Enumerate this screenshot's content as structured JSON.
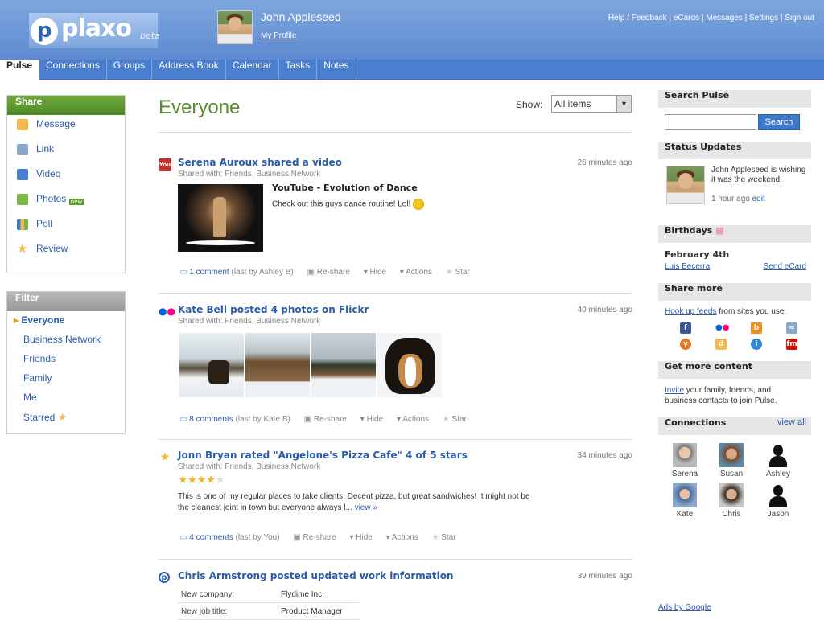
{
  "header": {
    "logo_text": "plaxo",
    "logo_beta": "beta",
    "user_name": "John Appleseed",
    "my_profile": "My Profile",
    "links": [
      "Help / Feedback",
      "eCards",
      "Messages",
      "Settings",
      "Sign out"
    ]
  },
  "tabs": [
    "Pulse",
    "Connections",
    "Groups",
    "Address Book",
    "Calendar",
    "Tasks",
    "Notes"
  ],
  "share": {
    "title": "Share",
    "items": [
      {
        "label": "Message",
        "icon": "message-icon",
        "color": "#f2b84b"
      },
      {
        "label": "Link",
        "icon": "link-icon",
        "color": "#8aa6c8"
      },
      {
        "label": "Video",
        "icon": "video-icon",
        "color": "#4a7fcf"
      },
      {
        "label": "Photos",
        "icon": "photos-icon",
        "color": "#7ab648",
        "badge": "new"
      },
      {
        "label": "Poll",
        "icon": "poll-icon",
        "color": "#3d78cc"
      },
      {
        "label": "Review",
        "icon": "star-icon",
        "color": "#f2b84b"
      }
    ]
  },
  "filter": {
    "title": "Filter",
    "items": [
      "Everyone",
      "Business Network",
      "Friends",
      "Family",
      "Me",
      "Starred"
    ]
  },
  "main": {
    "title": "Everyone",
    "show_label": "Show:",
    "show_value": "All items"
  },
  "feed": [
    {
      "title": "Serena Auroux shared a video",
      "time": "26 minutes ago",
      "shared": "Shared with: Friends, Business Network",
      "video_title": "YouTube - Evolution of Dance",
      "video_desc": "Check out this guys dance routine! Lol!",
      "comments": "1 comment",
      "comments_by": "(last by Ashley B)"
    },
    {
      "title": "Kate Bell posted 4 photos on Flickr",
      "time": "40 minutes ago",
      "shared": "Shared with: Friends, Business Network",
      "comments": "8 comments",
      "comments_by": "(last by Kate B)"
    },
    {
      "title": "Jonn Bryan rated \"Angelone's Pizza Cafe\" 4 of 5 stars",
      "time": "34 minutes ago",
      "shared": "Shared with: Friends, Business Network",
      "rating": 4,
      "rating_max": 5,
      "review": "This is one of my regular places to take clients. Decent pizza, but great sandwiches! It might not be the cleanest joint in town but everyone always l...",
      "view_more": "view »",
      "comments": "4 comments",
      "comments_by": "(last by You)"
    },
    {
      "title": "Chris Armstrong posted updated work information",
      "time": "39 minutes ago",
      "rows": [
        {
          "k": "New company:",
          "v": "Flydime Inc."
        },
        {
          "k": "New job title:",
          "v": "Product Manager"
        }
      ]
    }
  ],
  "actions": {
    "reshare": "Re-share",
    "hide": "Hide",
    "actions": "Actions",
    "star": "Star"
  },
  "right": {
    "search_title": "Search Pulse",
    "search_button": "Search",
    "status_title": "Status Updates",
    "status_text": "John Appleseed is wishing it was the weekend!",
    "status_time": "1 hour ago",
    "status_edit": "edit",
    "birthdays_title": "Birthdays",
    "birthday_date": "February 4th",
    "birthday_name": "Luis Becerra",
    "birthday_action": "Send eCard",
    "share_more_title": "Share more",
    "share_more_link": "Hook up feeds",
    "share_more_text": "from sites you use.",
    "get_more_title": "Get more content",
    "get_more_link": "Invite",
    "get_more_text": "your family, friends, and business contacts to join Pulse.",
    "connections_title": "Connections",
    "connections_view_all": "view all",
    "connections": [
      "Serena",
      "Susan",
      "Ashley",
      "Kate",
      "Chris",
      "Jason"
    ],
    "ads": "Ads by Google"
  }
}
